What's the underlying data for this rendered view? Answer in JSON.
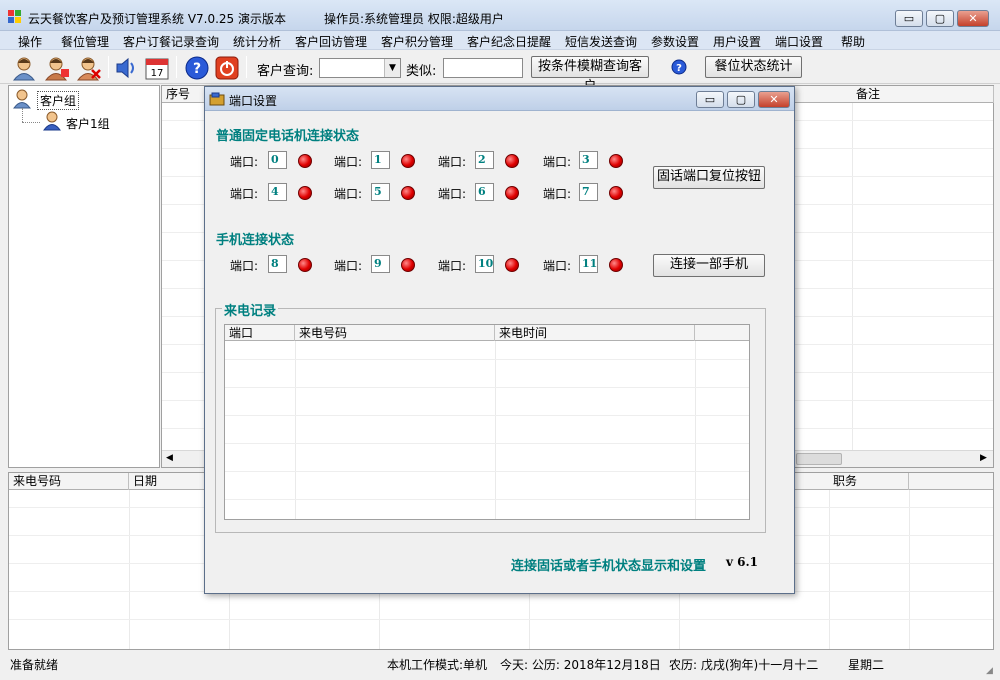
{
  "window": {
    "title": "云天餐饮客户及预订管理系统 V7.0.25 演示版本",
    "operator": "操作员:系统管理员  权限:超级用户",
    "min_label": "▭",
    "max_label": "▢",
    "close_label": "✕"
  },
  "menu": [
    "操作",
    "餐位管理",
    "客户订餐记录查询",
    "统计分析",
    "客户回访管理",
    "客户积分管理",
    "客户纪念日提醒",
    "短信发送查询",
    "参数设置",
    "用户设置",
    "端口设置",
    "帮助"
  ],
  "toolbar": {
    "customer_query_label": "客户查询:",
    "similar_label": "类似:",
    "fuzzy_query_button": "按条件模糊查询客户",
    "seat_status_button": "餐位状态统计",
    "calendar_day": "17"
  },
  "tree": {
    "root": "客户组",
    "child": "客户1组"
  },
  "main_grid": {
    "columns": [
      "序号",
      "备注"
    ]
  },
  "lower_grid": {
    "columns": [
      "来电号码",
      "日期",
      "职务"
    ]
  },
  "status": {
    "ready": "准备就绪",
    "mode": "本机工作模式:单机",
    "date": "今天: 公历: 2018年12月18日",
    "lunar": "农历: 戊戌(狗年)十一月十二",
    "weekday": "星期二"
  },
  "dialog": {
    "title": "端口设置",
    "landline_section": "普通固定电话机连接状态",
    "mobile_section": "手机连接状态",
    "port_label": "端口:",
    "landline_ports": [
      "0",
      "1",
      "2",
      "3",
      "4",
      "5",
      "6",
      "7"
    ],
    "mobile_ports": [
      "8",
      "9",
      "10",
      "11"
    ],
    "reset_button": "固话端口复位按钮",
    "connect_phone_button": "连接一部手机",
    "call_log_title": "来电记录",
    "call_log_columns": [
      "端口",
      "来电号码",
      "来电时间"
    ],
    "footer": "连接固话或者手机状态显示和设置",
    "version": "v 6.1"
  },
  "colors": {
    "accent_teal": "#008080",
    "led_red": "#e00000"
  }
}
